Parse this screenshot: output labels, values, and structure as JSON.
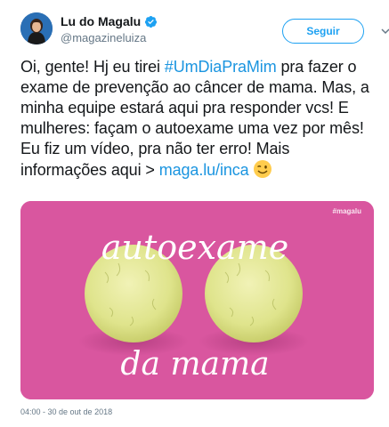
{
  "user": {
    "display_name": "Lu do Magalu",
    "handle": "@magazineluiza",
    "verified": true,
    "avatar_icon": "avatar-portrait"
  },
  "follow_label": "Seguir",
  "tweet": {
    "text_before": "Oi, gente! Hj eu tirei ",
    "hashtag": "#UmDiaPraMim",
    "text_middle": " pra fazer o exame de prevenção ao câncer de mama. Mas, a minha equipe estará aqui pra responder vcs! E mulheres: façam o autoexame uma vez por mês! Eu fiz um vídeo, pra não ter erro! Mais informações aqui > ",
    "link": "maga.lu/inca",
    "emoji": "winking-face"
  },
  "media": {
    "watermark": "#magalu",
    "caption_top": "autoexame",
    "caption_bottom": "da mama"
  },
  "timestamp": "04:00 - 30 de out de 2018",
  "colors": {
    "accent": "#1da1f2",
    "link": "#1b95e0",
    "media_bg": "#d9569f"
  }
}
